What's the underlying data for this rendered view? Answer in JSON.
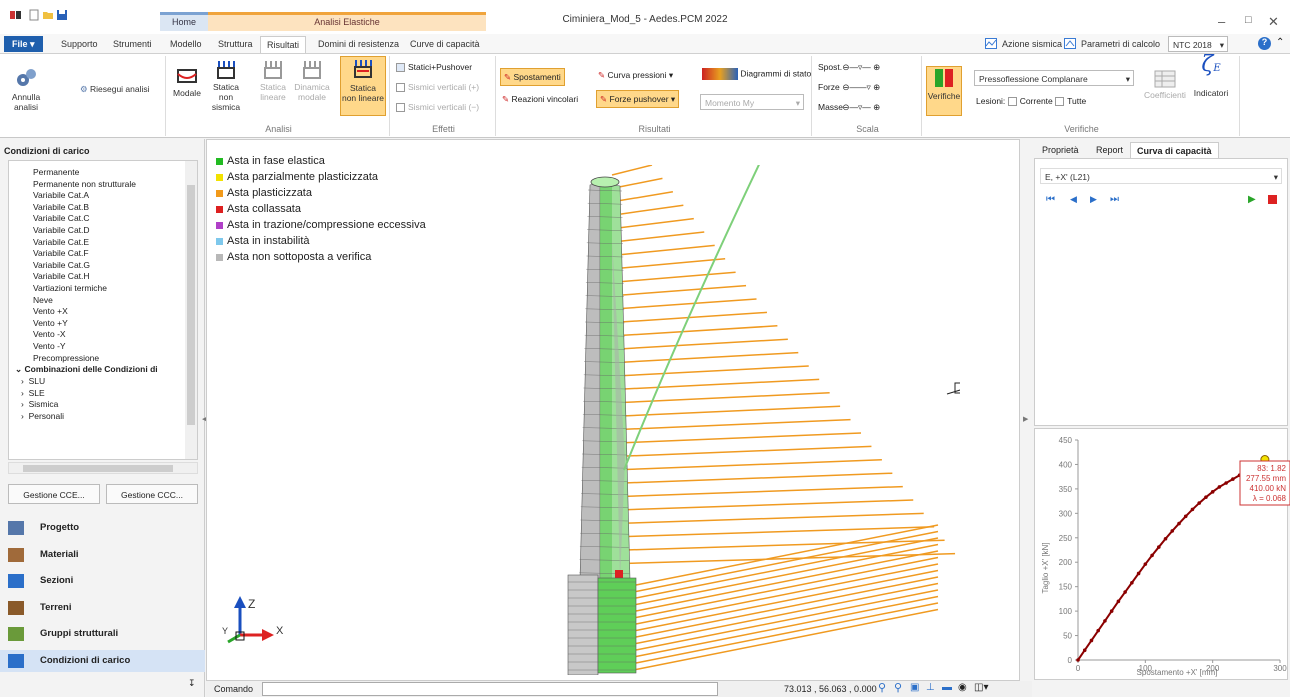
{
  "app": {
    "title": "Ciminiera_Mod_5 - Aedes.PCM 2022"
  },
  "context_tabs": {
    "home": "Home",
    "analisi": "Analisi Elastiche"
  },
  "tabs": [
    "File",
    "Supporto",
    "Strumenti",
    "Modello",
    "Struttura",
    "Risultati",
    "Domini di resistenza",
    "Curve di capacità"
  ],
  "topright": {
    "azione": "Azione sismica",
    "parametri": "Parametri di calcolo",
    "ntc": "NTC 2018"
  },
  "ribbon": {
    "annulla": "Annulla analisi",
    "riesegui": "Riesegui analisi",
    "modale": "Modale",
    "statica_ns_1": "Statica",
    "statica_ns_2": "non sismica",
    "statica_lin_1": "Statica",
    "statica_lin_2": "lineare",
    "dinamica_1": "Dinamica",
    "dinamica_2": "modale",
    "statica_nl_1": "Statica",
    "statica_nl_2": "non lineare",
    "analisi_group": "Analisi",
    "statici_push": "Statici+Pushover",
    "sismici_plus": "Sismici verticali (+)",
    "sismici_minus": "Sismici verticali (−)",
    "effetti_group": "Effetti",
    "spostamenti": "Spostamenti",
    "reazioni": "Reazioni vincolari",
    "curva_pressioni": "Curva pressioni",
    "forze_pushover": "Forze pushover",
    "diagrammi": "Diagrammi di stato",
    "momento": "Momento My",
    "risultati_group": "Risultati",
    "spost": "Spost.",
    "forze": "Forze",
    "masse": "Masse",
    "scala_group": "Scala",
    "verifiche": "Verifiche",
    "pressoflessione": "Pressoflessione Complanare",
    "lesioni": "Lesioni:",
    "corrente": "Corrente",
    "tutte": "Tutte",
    "coefficienti": "Coefficienti",
    "indicatori": "Indicatori",
    "verifiche_group": "Verifiche"
  },
  "left": {
    "header": "Condizioni di carico",
    "items": [
      "Permanente",
      "Permanente non strutturale",
      "Variabile Cat.A",
      "Variabile Cat.B",
      "Variabile Cat.C",
      "Variabile Cat.D",
      "Variabile Cat.E",
      "Variabile Cat.F",
      "Variabile Cat.G",
      "Variabile Cat.H",
      "Vartiazioni termiche",
      "Neve",
      "Vento +X",
      "Vento +Y",
      "Vento -X",
      "Vento -Y",
      "Precompressione"
    ],
    "combo_header": "Combinazioni delle Condizioni di",
    "combo_items": [
      "SLU",
      "SLE",
      "Sismica",
      "Personali"
    ],
    "btn_cce": "Gestione CCE...",
    "btn_ccc": "Gestione CCC...",
    "nav": [
      "Progetto",
      "Materiali",
      "Sezioni",
      "Terreni",
      "Gruppi strutturali",
      "Condizioni di carico"
    ]
  },
  "legend": [
    {
      "label": "Asta in fase elastica",
      "color": "#22bb22"
    },
    {
      "label": "Asta parzialmente plasticizzata",
      "color": "#f2e200"
    },
    {
      "label": "Asta plasticizzata",
      "color": "#f29a1a"
    },
    {
      "label": "Asta collassata",
      "color": "#dd2020"
    },
    {
      "label": "Asta in trazione/compressione eccessiva",
      "color": "#b040c8"
    },
    {
      "label": "Asta in instabilità",
      "color": "#7ec8ec"
    },
    {
      "label": "Asta non sottoposta a verifica",
      "color": "#b8b8b8"
    }
  ],
  "axes": {
    "z": "Z",
    "x": "X",
    "y": "Y"
  },
  "right": {
    "tabs": [
      "Proprietà",
      "Report",
      "Curva di capacità"
    ],
    "combo": "E, +X' (L21)",
    "chart_tip": [
      "83: 1.82",
      "277.55 mm",
      "410.00 kN",
      "λ = 0.068"
    ]
  },
  "chart_data": {
    "type": "line",
    "xlabel": "Spostamento +X' [mm]",
    "ylabel": "Taglio +X' [kN]",
    "xlim": [
      0,
      300
    ],
    "ylim": [
      0,
      450
    ],
    "xticks": [
      0,
      100,
      200,
      300
    ],
    "yticks": [
      0,
      50,
      100,
      150,
      200,
      250,
      300,
      350,
      400,
      450
    ],
    "x": [
      0,
      10,
      20,
      30,
      40,
      50,
      60,
      70,
      80,
      90,
      100,
      110,
      120,
      130,
      140,
      150,
      160,
      170,
      180,
      190,
      200,
      210,
      220,
      230,
      240,
      250,
      260,
      270,
      277.55
    ],
    "y": [
      0,
      20,
      40,
      60,
      80,
      100,
      120,
      139,
      158,
      177,
      196,
      214,
      231,
      248,
      264,
      279,
      294,
      308,
      321,
      333,
      344,
      354,
      362,
      370,
      378,
      386,
      394,
      402,
      410
    ],
    "grid": false
  },
  "status": {
    "comando": "Comando",
    "coords": "73.013 , 56.063 , 0.000"
  }
}
